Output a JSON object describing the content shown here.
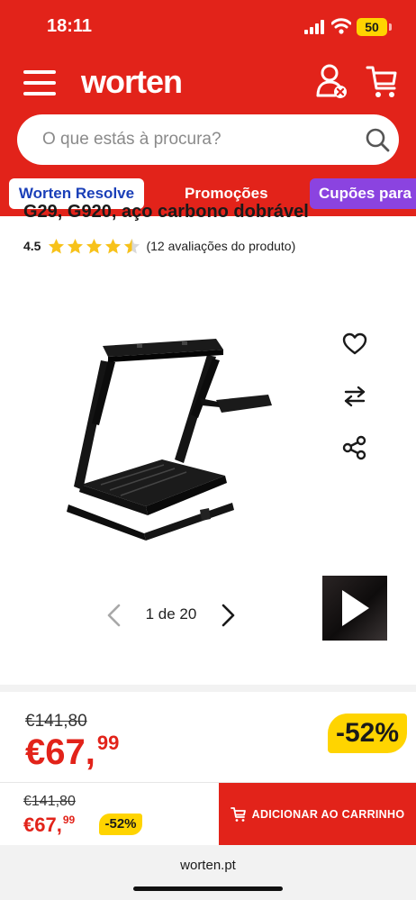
{
  "status_bar": {
    "time": "18:11",
    "battery": "50"
  },
  "header": {
    "logo": "worten",
    "search": {
      "placeholder": "O que estás à procura?"
    },
    "nav": [
      "Worten Resolve",
      "Promoções",
      "Cupões para"
    ]
  },
  "product": {
    "title_partial": "G29, G920, aço carbono dobrável",
    "rating": "4.5",
    "stars_filled": 4.5,
    "stars_total": 5,
    "reviews": "(12 avaliações do produto)",
    "gallery": {
      "counter": "1 de 20"
    }
  },
  "price": {
    "old": "€141,80",
    "current_main": "€67,",
    "current_cents": "99",
    "discount": "-52%"
  },
  "sticky_bar": {
    "old": "€141,80",
    "current_main": "€67,",
    "current_cents": "99",
    "discount": "-52%",
    "add_to_cart": "ADICIONAR AO CARRINHO"
  },
  "browser": {
    "url": "worten.pt"
  },
  "icons": {
    "menu": "menu-icon",
    "user": "user-icon",
    "cart": "cart-icon",
    "search": "search-icon",
    "wishlist": "heart-icon",
    "compare": "compare-arrows-icon",
    "share": "share-icon",
    "prev": "chevron-left-icon",
    "next": "chevron-right-icon",
    "video": "play-icon"
  },
  "colors": {
    "brand_red": "#e2231a",
    "discount_yellow": "#ffd400",
    "resolve_blue": "#1a3fb8",
    "coupon_purple": "#8b43e0",
    "star_yellow": "#f7c21a"
  }
}
